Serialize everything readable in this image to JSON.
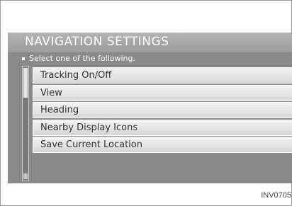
{
  "screen": {
    "title": "NAVIGATION SETTINGS",
    "instruction": "Select one of the following."
  },
  "menu": {
    "items": [
      {
        "label": "Tracking On/Off"
      },
      {
        "label": "View"
      },
      {
        "label": "Heading"
      },
      {
        "label": "Nearby Display Icons"
      },
      {
        "label": "Save Current Location"
      }
    ]
  },
  "footer": {
    "image_code": "INV0705"
  }
}
